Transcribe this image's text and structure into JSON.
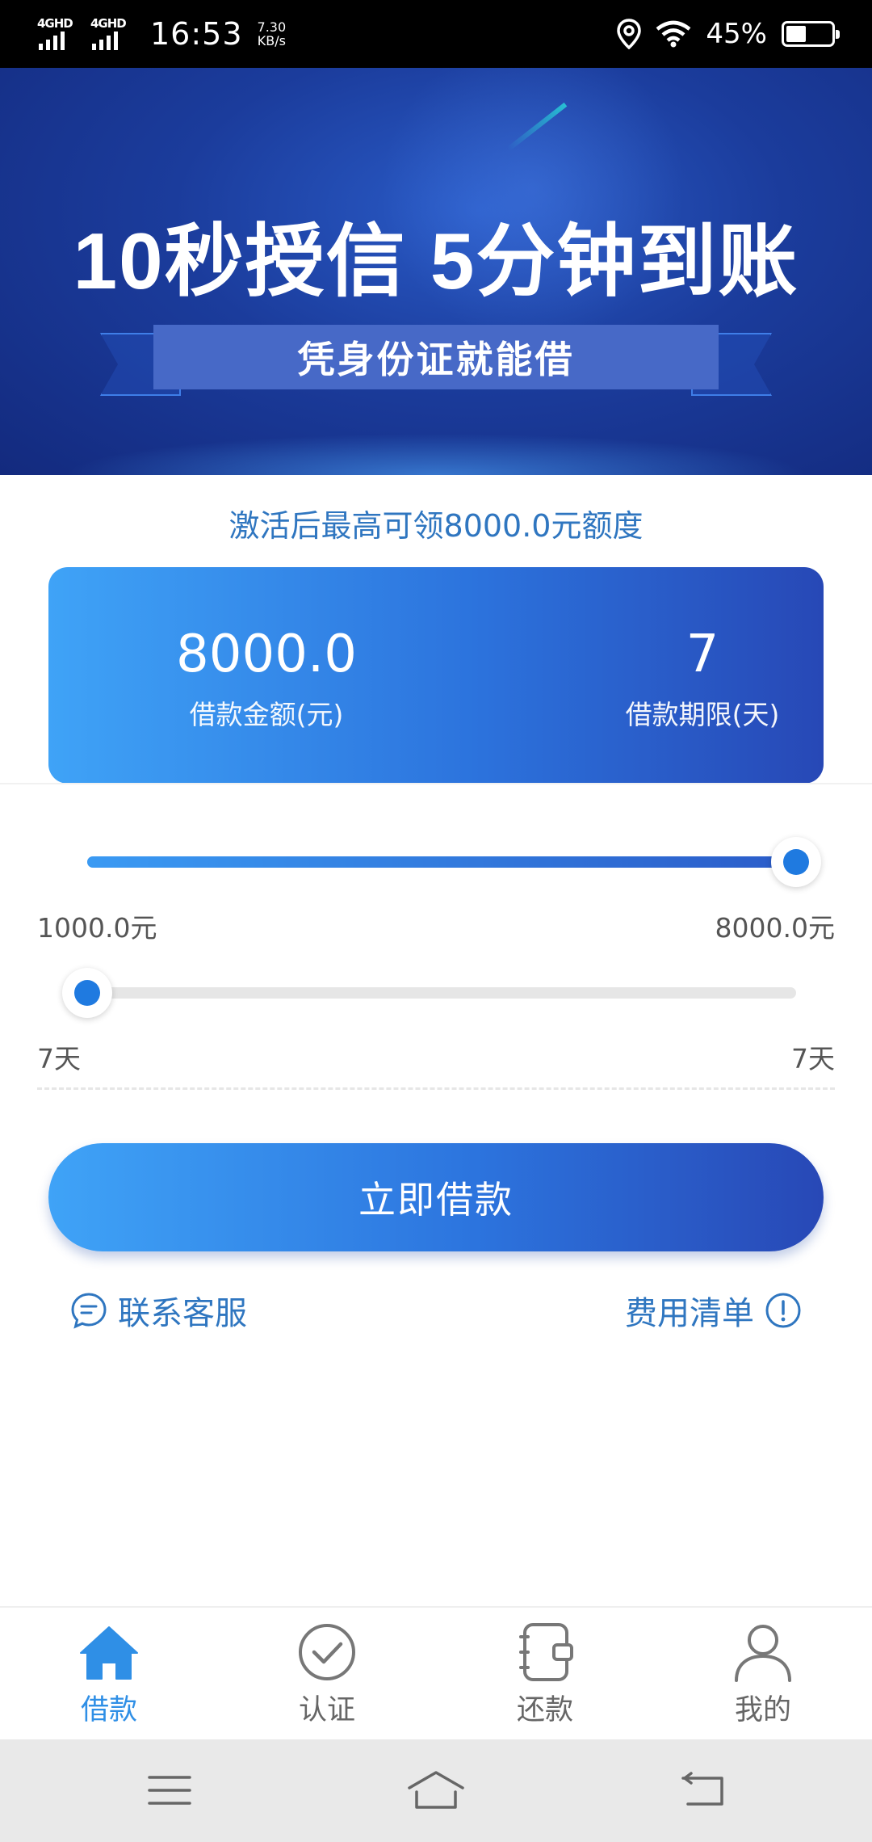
{
  "status_bar": {
    "network_1": "4GHD",
    "network_2": "4GHD",
    "time": "16:53",
    "speed_value": "7.30",
    "speed_unit": "KB/s",
    "battery": "45%"
  },
  "banner": {
    "title": "10秒授信 5分钟到账",
    "ribbon": "凭身份证就能借"
  },
  "credit_note": "激活后最高可领8000.0元额度",
  "loan": {
    "amount_value": "8000.0",
    "amount_label": "借款金额(元)",
    "term_value": "7",
    "term_label": "借款期限(天)"
  },
  "amount_slider": {
    "min_label": "1000.0元",
    "max_label": "8000.0元",
    "level": 1.0
  },
  "term_slider": {
    "min_label": "7天",
    "max_label": "7天",
    "level": 0.0
  },
  "borrow_button": "立即借款",
  "links": {
    "contact": "联系客服",
    "fees": "费用清单"
  },
  "tabs": [
    {
      "label": "借款",
      "icon": "home-icon",
      "active": true
    },
    {
      "label": "认证",
      "icon": "check-circle-icon",
      "active": false
    },
    {
      "label": "还款",
      "icon": "notebook-icon",
      "active": false
    },
    {
      "label": "我的",
      "icon": "user-icon",
      "active": false
    }
  ],
  "colors": {
    "accent": "#2f8fe6",
    "link": "#2f76c0",
    "gradient_start": "#3fa3f7",
    "gradient_end": "#2748b6"
  }
}
